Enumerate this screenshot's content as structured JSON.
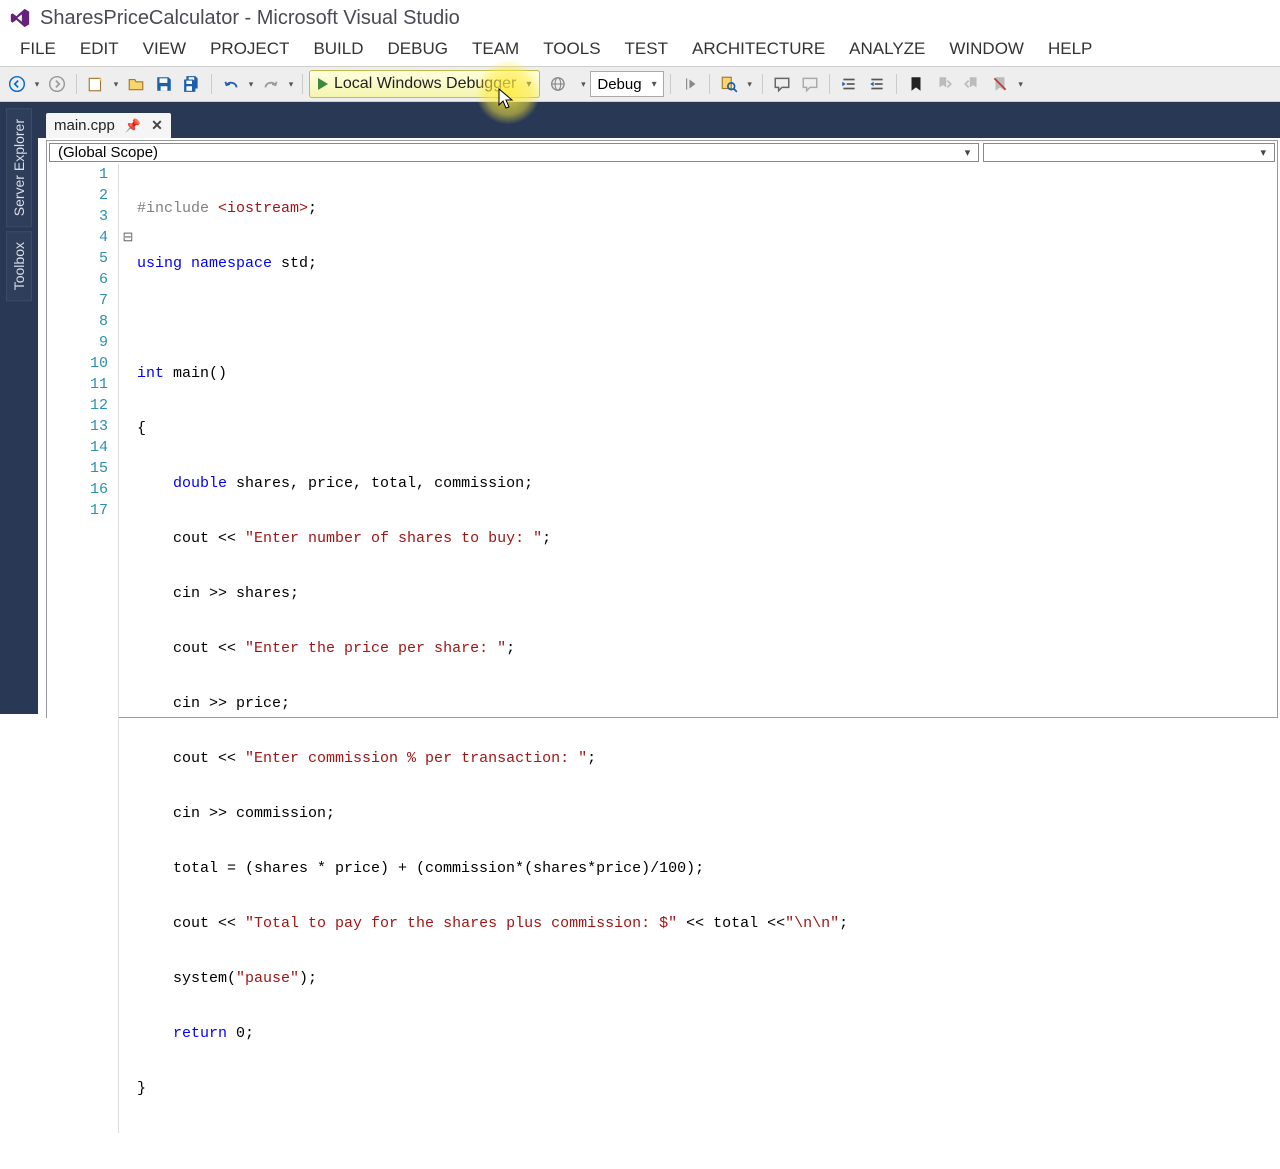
{
  "window": {
    "title": "SharesPriceCalculator - Microsoft Visual Studio"
  },
  "menu": {
    "items": [
      "FILE",
      "EDIT",
      "VIEW",
      "PROJECT",
      "BUILD",
      "DEBUG",
      "TEAM",
      "TOOLS",
      "TEST",
      "ARCHITECTURE",
      "ANALYZE",
      "WINDOW",
      "HELP"
    ]
  },
  "toolbar": {
    "debugger_label": "Local Windows Debugger",
    "config_label": "Debug"
  },
  "side_tabs": {
    "server_explorer": "Server Explorer",
    "toolbox": "Toolbox"
  },
  "tab": {
    "name": "main.cpp"
  },
  "scope": {
    "global": "(Global Scope)"
  },
  "code": {
    "lines": [
      1,
      2,
      3,
      4,
      5,
      6,
      7,
      8,
      9,
      10,
      11,
      12,
      13,
      14,
      15,
      16,
      17
    ],
    "l1_a": "#include ",
    "l1_b": "<iostream>",
    "l1_c": ";",
    "l2_a": "using",
    "l2_b": " ",
    "l2_c": "namespace",
    "l2_d": " std;",
    "l3": "",
    "l4_a": "int",
    "l4_b": " main()",
    "l5": "{",
    "l6_a": "    ",
    "l6_b": "double",
    "l6_c": " shares, price, total, commission;",
    "l7_a": "    cout << ",
    "l7_b": "\"Enter number of shares to buy: \"",
    "l7_c": ";",
    "l8": "    cin >> shares;",
    "l9_a": "    cout << ",
    "l9_b": "\"Enter the price per share: \"",
    "l9_c": ";",
    "l10": "    cin >> price;",
    "l11_a": "    cout << ",
    "l11_b": "\"Enter commission % per transaction: \"",
    "l11_c": ";",
    "l12": "    cin >> commission;",
    "l13": "    total = (shares * price) + (commission*(shares*price)/100);",
    "l14_a": "    cout << ",
    "l14_b": "\"Total to pay for the shares plus commission: $\"",
    "l14_c": " << total <<",
    "l14_d": "\"\\n\\n\"",
    "l14_e": ";",
    "l15_a": "    system(",
    "l15_b": "\"pause\"",
    "l15_c": ");",
    "l16_a": "    ",
    "l16_b": "return",
    "l16_c": " 0;",
    "l17": "}"
  }
}
